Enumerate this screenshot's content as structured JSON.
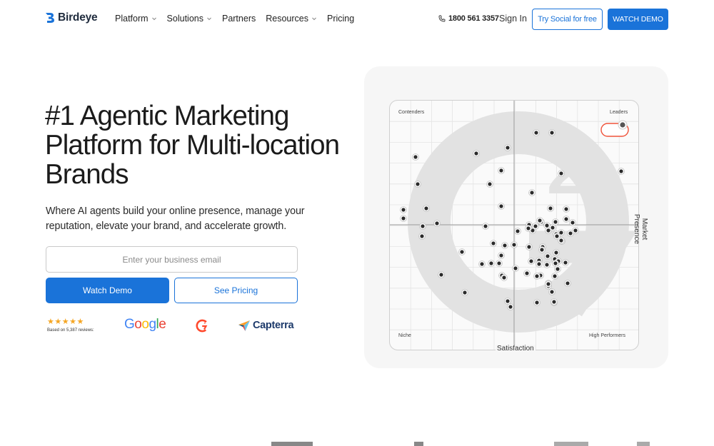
{
  "brand": {
    "name": "Birdeye",
    "color": "#1a73d9"
  },
  "nav": {
    "items": [
      {
        "label": "Platform",
        "dropdown": true
      },
      {
        "label": "Solutions",
        "dropdown": true
      },
      {
        "label": "Partners",
        "dropdown": false
      },
      {
        "label": "Resources",
        "dropdown": true
      },
      {
        "label": "Pricing",
        "dropdown": false
      }
    ],
    "phone": "1800 561 3357",
    "signin": "Sign In",
    "social_button": "Try Social for free",
    "demo_button": "WATCH DEMO"
  },
  "hero": {
    "title": "#1 Agentic Marketing Platform for Multi-location Brands",
    "subtitle": "Where AI agents build your online presence, manage your reputation, elevate your brand, and accelerate growth.",
    "email_placeholder": "Enter your business email",
    "watch_demo": "Watch Demo",
    "see_pricing": "See Pricing"
  },
  "social_proof": {
    "stars": "★★★★★",
    "reviews": "Based on 5,387 reviews:",
    "google": "Google",
    "capterra": "Capterra"
  },
  "grid": {
    "quadrants": {
      "top_left": "Contenders",
      "top_right": "Leaders",
      "bottom_left": "Niche",
      "bottom_right": "High Performers"
    },
    "x_axis": "Satisfaction",
    "y_axis": "Market Presence"
  }
}
